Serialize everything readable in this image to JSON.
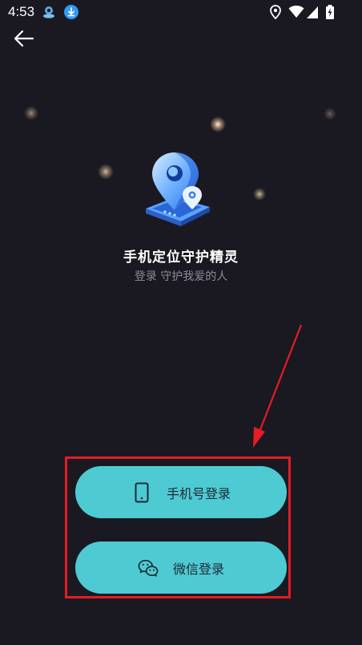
{
  "status_bar": {
    "time": "4:53",
    "left_icons": [
      "app-notification-icon",
      "download-icon"
    ],
    "right_icons": [
      "location-icon",
      "wifi-icon",
      "cell-signal-icon",
      "battery-charging-icon"
    ]
  },
  "header": {
    "back_icon": "arrow-left-icon"
  },
  "branding": {
    "logo_icon": "location-pin-logo-icon",
    "title": "手机定位守护精灵",
    "subtitle": "登录 守护我爱的人"
  },
  "login": {
    "phone_label": "手机号登录",
    "phone_icon": "smartphone-icon",
    "wechat_label": "微信登录",
    "wechat_icon": "wechat-icon"
  },
  "colors": {
    "background": "#1a1922",
    "button": "#4ecad3",
    "button_text": "#1e2a33",
    "annotation": "#e51c23",
    "subtitle": "#8b8a96"
  }
}
